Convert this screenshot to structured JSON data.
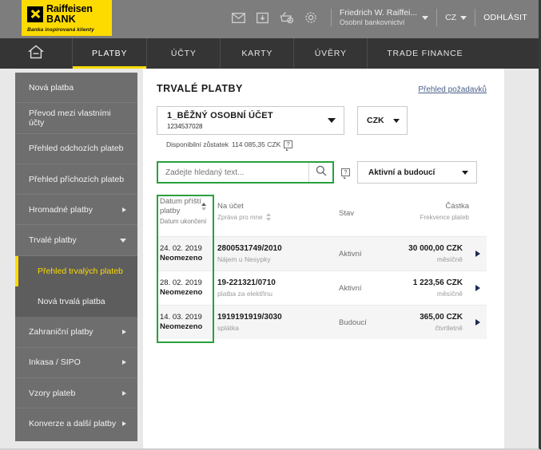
{
  "brand": {
    "name_line1": "Raiffeisen",
    "name_line2": "BANK",
    "tagline": "Banka inspirovaná klienty",
    "logo_bg": "#fddb00",
    "accent": "#fddb00",
    "highlight": "#2aa03c"
  },
  "header": {
    "icons": [
      "mail-icon",
      "inbox-download-icon",
      "basket-clock-icon",
      "gear-icon"
    ],
    "user_name": "Friedrich W. Raiffei...",
    "user_role": "Osobní bankovnictví",
    "language": "CZ",
    "logout": "ODHLÁSIT"
  },
  "nav": {
    "home_icon": "home-icon",
    "items": [
      {
        "label": "PLATBY",
        "active": true
      },
      {
        "label": "ÚČTY",
        "active": false
      },
      {
        "label": "KARTY",
        "active": false
      },
      {
        "label": "ÚVĚRY",
        "active": false
      },
      {
        "label": "TRADE FINANCE",
        "active": false
      }
    ]
  },
  "sidebar": {
    "items": [
      {
        "label": "Nová platba",
        "arrow": "none"
      },
      {
        "label": "Převod mezi vlastními účty",
        "arrow": "none"
      },
      {
        "label": "Přehled odchozích plateb",
        "arrow": "none"
      },
      {
        "label": "Přehled příchozích plateb",
        "arrow": "none"
      },
      {
        "label": "Hromadné platby",
        "arrow": "right"
      },
      {
        "label": "Trvalé platby",
        "arrow": "down"
      }
    ],
    "sub_items": [
      {
        "label": "Přehled trvalých plateb",
        "active": true
      },
      {
        "label": "Nová trvalá platba",
        "active": false
      }
    ],
    "items_after": [
      {
        "label": "Zahraniční platby",
        "arrow": "right"
      },
      {
        "label": "Inkasa / SIPO",
        "arrow": "right"
      },
      {
        "label": "Vzory plateb",
        "arrow": "right"
      },
      {
        "label": "Konverze a další platby",
        "arrow": "right"
      }
    ]
  },
  "main": {
    "title": "TRVALÉ PLATBY",
    "requests_link": "Přehled požadavků",
    "account": {
      "name": "1_BĚŽNÝ OSOBNÍ ÚČET",
      "number": "1234537028"
    },
    "currency": "CZK",
    "balance_label": "Disponibilní zůstatek",
    "balance_value": "114 085,35 CZK",
    "balance_help_icon": "help-bubble-icon",
    "search": {
      "placeholder": "Zadejte hledaný text...",
      "value": "",
      "icon": "search-icon"
    },
    "filter_help_icon": "help-bubble-icon",
    "state_filter": "Aktivní a budoucí"
  },
  "table": {
    "headers": {
      "date_primary": "Datum příští platby",
      "date_secondary": "Datum ukončení",
      "account_primary": "Na účet",
      "account_secondary": "Zpráva pro mne",
      "state": "Stav",
      "amount_primary": "Částka",
      "amount_secondary": "Frekvence plateb"
    },
    "rows": [
      {
        "date": "24. 02. 2019",
        "end_date": "Neomezeno",
        "account": "2800531749/2010",
        "note": "Nájem u Nesypky",
        "state": "Aktivní",
        "amount": "30 000,00 CZK",
        "frequency": "měsíčně"
      },
      {
        "date": "28. 02. 2019",
        "end_date": "Neomezeno",
        "account": "19-221321/0710",
        "note": "platba za elektřinu",
        "state": "Aktivní",
        "amount": "1 223,56 CZK",
        "frequency": "měsíčně"
      },
      {
        "date": "14. 03. 2019",
        "end_date": "Neomezeno",
        "account": "1919191919/3030",
        "note": "splátka",
        "state": "Budoucí",
        "amount": "365,00 CZK",
        "frequency": "čtvrtletně"
      }
    ]
  }
}
